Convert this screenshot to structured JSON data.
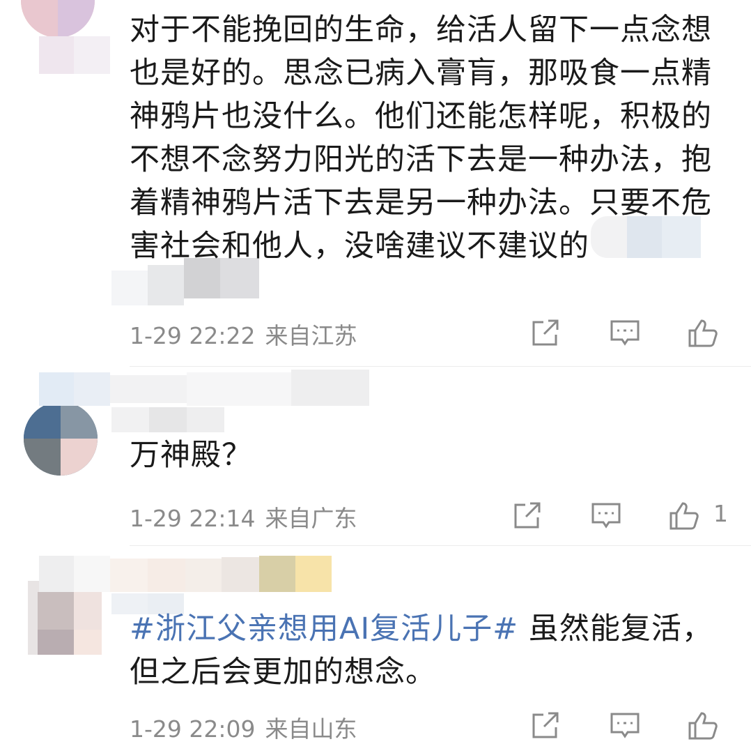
{
  "comments": [
    {
      "text": "对于不能挽回的生命，给活人留下一点念想也是好的。思念已病入膏肓，那吸食一点精神鸦片也没什么。他们还能怎样呢，积极的不想不念努力阳光的活下去是一种办法，抱着精神鸦片活下去是另一种办法。只要不危害社会和他人，没啥建议不建议的",
      "time": "1-29 22:22",
      "location": "来自江苏",
      "likes": ""
    },
    {
      "text": "万神殿？",
      "time": "1-29 22:14",
      "location": "来自广东",
      "likes": "1"
    },
    {
      "hashtag": "#浙江父亲想用AI复活儿子#",
      "text": " 虽然能复活，但之后会更加的想念。",
      "time": "1-29 22:09",
      "location": "来自山东",
      "likes": ""
    }
  ],
  "icons": {
    "share": "share-icon",
    "comment": "comment-icon",
    "like": "thumbs-up-icon"
  },
  "colors": {
    "text": "#1a1a1a",
    "meta": "#8a8a8a",
    "hashtag": "#4a73b3",
    "icon": "#8a8a8a"
  }
}
